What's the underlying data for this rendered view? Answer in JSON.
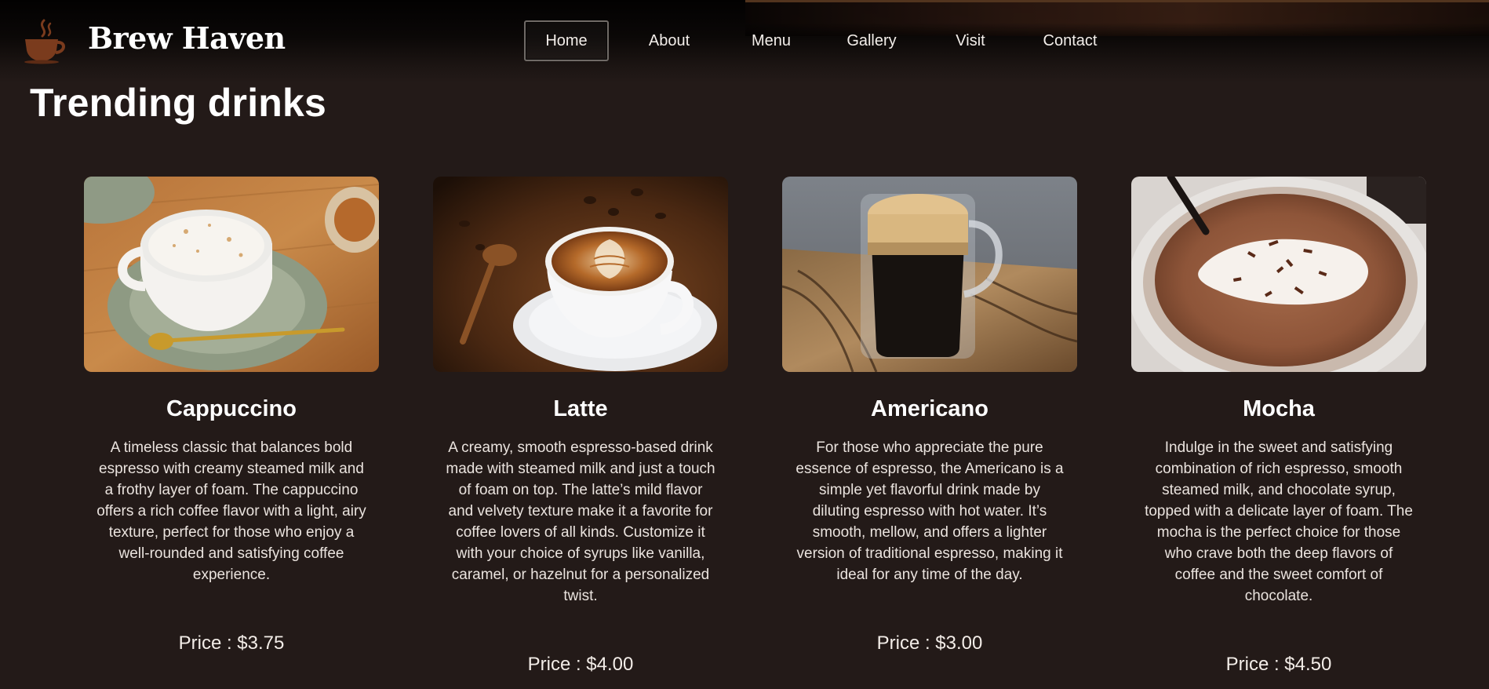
{
  "brand": {
    "name": "Brew Haven",
    "logo_icon": "coffee-cup-icon"
  },
  "nav": {
    "items": [
      {
        "label": "Home",
        "active": true
      },
      {
        "label": "About",
        "active": false
      },
      {
        "label": "Menu",
        "active": false
      },
      {
        "label": "Gallery",
        "active": false
      },
      {
        "label": "Visit",
        "active": false
      },
      {
        "label": "Contact",
        "active": false
      }
    ]
  },
  "section": {
    "title": "Trending drinks"
  },
  "drinks": [
    {
      "name": "Cappuccino",
      "description": "A timeless classic that balances bold espresso with creamy steamed milk and a frothy layer of foam. The cappuccino offers a rich coffee flavor with a light, airy texture, perfect for those who enjoy a well-rounded and satisfying coffee experience.",
      "price": "Price : $3.75",
      "image": "cappuccino-photo"
    },
    {
      "name": "Latte",
      "description": "A creamy, smooth espresso-based drink made with steamed milk and just a touch of foam on top. The latte’s mild flavor and velvety texture make it a favorite for coffee lovers of all kinds. Customize it with your choice of syrups like vanilla, caramel, or hazelnut for a personalized twist.",
      "price": "Price : $4.00",
      "image": "latte-photo"
    },
    {
      "name": "Americano",
      "description": "For those who appreciate the pure essence of espresso, the Americano is a simple yet flavorful drink made by diluting espresso with hot water. It’s smooth, mellow, and offers a lighter version of traditional espresso, making it ideal for any time of the day.",
      "price": "Price : $3.00",
      "image": "americano-photo"
    },
    {
      "name": "Mocha",
      "description": "Indulge in the sweet and satisfying combination of rich espresso, smooth steamed milk, and chocolate syrup, topped with a delicate layer of foam. The mocha is the perfect choice for those who crave both the deep flavors of coffee and the sweet comfort of chocolate.",
      "price": "Price : $4.50",
      "image": "mocha-photo"
    }
  ],
  "colors": {
    "background": "#231a18",
    "header": "#050303",
    "text": "#ffffff",
    "logo": "#7a3b1d"
  }
}
